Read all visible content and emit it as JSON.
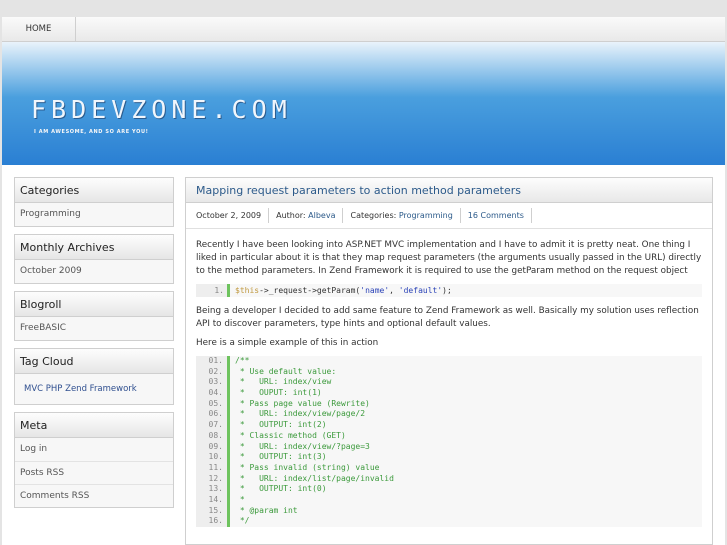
{
  "nav": {
    "home": "HOME"
  },
  "header": {
    "logo": "FBDEVZONE.COM",
    "tagline": "I AM AWESOME, AND SO ARE YOU!"
  },
  "sidebar": {
    "categories": {
      "title": "Categories",
      "items": [
        "Programming"
      ]
    },
    "archives": {
      "title": "Monthly Archives",
      "items": [
        "October 2009"
      ]
    },
    "blogroll": {
      "title": "Blogroll",
      "items": [
        "FreeBASIC"
      ]
    },
    "tags": {
      "title": "Tag Cloud",
      "text": "MVC PHP Zend Framework"
    },
    "meta": {
      "title": "Meta",
      "items": [
        "Log in",
        "Posts RSS",
        "Comments RSS"
      ]
    }
  },
  "post": {
    "title": "Mapping request parameters to action method parameters",
    "date": "October 2, 2009",
    "author_label": "Author:",
    "author": "Albeva",
    "categories_label": "Categories:",
    "category": "Programming",
    "comments": "16 Comments",
    "p1": "Recently I have been looking into ASP.NET MVC implementation and I have to admit it is pretty neat. One thing I liked in particular about it is that they map request parameters (the arguments usually passed in the URL) directly to the method parameters. In Zend Framework it is required to use the getParam method on the request object",
    "code1": {
      "ln": "1.",
      "var": "$this",
      "mid": "->_request->getParam(",
      "s1": "'name'",
      "comma": ", ",
      "s2": "'default'",
      "end": ");"
    },
    "p2": "Being a developer I decided to add same feature to Zend Framework as well. Basically my solution uses reflection API to discover parameters, type hints and optional default values.",
    "p3": "Here is a simple example of this in action",
    "code2": [
      {
        "ln": "01.",
        "text": "/**"
      },
      {
        "ln": "02.",
        "text": " * Use default value:"
      },
      {
        "ln": "03.",
        "text": " *   URL: index/view"
      },
      {
        "ln": "04.",
        "text": " *   OUPUT: int(1)"
      },
      {
        "ln": "05.",
        "text": " * Pass page value (Rewrite)"
      },
      {
        "ln": "06.",
        "text": " *   URL: index/view/page/2"
      },
      {
        "ln": "07.",
        "text": " *   OUTPUT: int(2)"
      },
      {
        "ln": "08.",
        "text": " * Classic method (GET)"
      },
      {
        "ln": "09.",
        "text": " *   URL: index/view/?page=3"
      },
      {
        "ln": "10.",
        "text": " *   OUTPUT: int(3)"
      },
      {
        "ln": "11.",
        "text": " * Pass invalid (string) value"
      },
      {
        "ln": "12.",
        "text": " *   URL: index/list/page/invalid"
      },
      {
        "ln": "13.",
        "text": " *   OUTPUT: int(0)"
      },
      {
        "ln": "14.",
        "text": " *"
      },
      {
        "ln": "15.",
        "text": " * @param int"
      },
      {
        "ln": "16.",
        "text": " */"
      }
    ]
  }
}
